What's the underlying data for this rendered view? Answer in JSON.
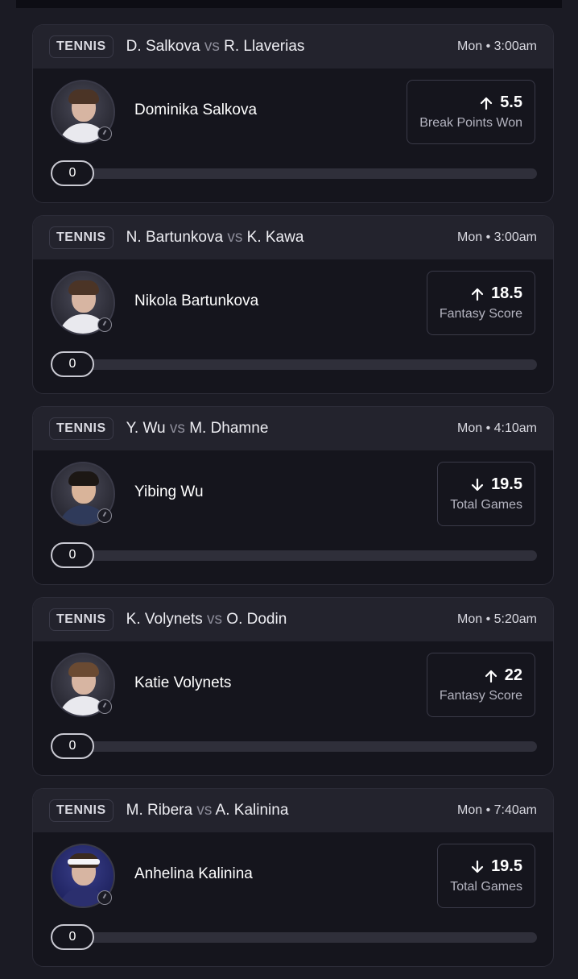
{
  "picks": [
    {
      "sport": "TENNIS",
      "team_a": "D. Salkova",
      "vs": "vs",
      "team_b": "R. Llaverias",
      "time": "Mon • 3:00am",
      "player": "Dominika Salkova",
      "direction": "up",
      "direction_icon": "arrow-up-icon",
      "line": "5.5",
      "stat": "Break Points Won",
      "progress_value": "0",
      "progress_fraction": 0
    },
    {
      "sport": "TENNIS",
      "team_a": "N. Bartunkova",
      "vs": "vs",
      "team_b": "K. Kawa",
      "time": "Mon • 3:00am",
      "player": "Nikola Bartunkova",
      "direction": "up",
      "direction_icon": "arrow-up-icon",
      "line": "18.5",
      "stat": "Fantasy Score",
      "progress_value": "0",
      "progress_fraction": 0
    },
    {
      "sport": "TENNIS",
      "team_a": "Y. Wu",
      "vs": "vs",
      "team_b": "M. Dhamne",
      "time": "Mon • 4:10am",
      "player": "Yibing Wu",
      "direction": "down",
      "direction_icon": "arrow-down-icon",
      "line": "19.5",
      "stat": "Total Games",
      "progress_value": "0",
      "progress_fraction": 0
    },
    {
      "sport": "TENNIS",
      "team_a": "K. Volynets",
      "vs": "vs",
      "team_b": "O. Dodin",
      "time": "Mon • 5:20am",
      "player": "Katie Volynets",
      "direction": "up",
      "direction_icon": "arrow-up-icon",
      "line": "22",
      "stat": "Fantasy Score",
      "progress_value": "0",
      "progress_fraction": 0
    },
    {
      "sport": "TENNIS",
      "team_a": "M. Ribera",
      "vs": "vs",
      "team_b": "A. Kalinina",
      "time": "Mon • 7:40am",
      "player": "Anhelina Kalinina",
      "direction": "down",
      "direction_icon": "arrow-down-icon",
      "line": "19.5",
      "stat": "Total Games",
      "progress_value": "0",
      "progress_fraction": 0
    }
  ],
  "colors": {
    "background": "#1b1b24",
    "card": "#15151d",
    "card_header": "#23232d",
    "border": "#3a3a48",
    "track": "#2f2f3a",
    "text": "#ffffff",
    "muted_text": "#b3b3bf"
  }
}
